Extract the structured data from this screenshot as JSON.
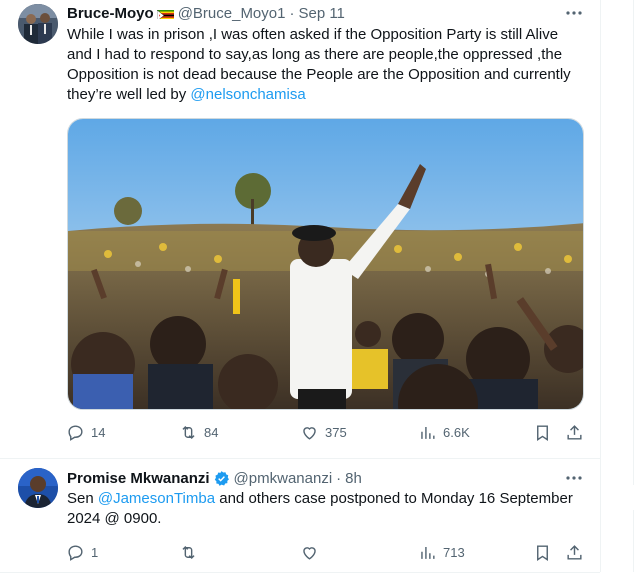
{
  "tweets": [
    {
      "author_name": "Bruce-Moyo",
      "flag_icon": "zimbabwe-flag-icon",
      "handle": "@Bruce_Moyo1",
      "dot": "·",
      "time": "Sep 11",
      "text_before": "While I was in prison ,I was often asked if the Opposition Party is still Alive and I had to respond to say,as long as there are people,the oppressed ,the Opposition is not dead because the People are the Opposition and currently they’re well led by ",
      "mention": "@nelsonchamisa",
      "text_after": "",
      "has_media": true,
      "replies": "14",
      "reposts": "84",
      "likes": "375",
      "views": "6.6K"
    },
    {
      "author_name": "Promise Mkwananzi",
      "verified_icon": "verified-badge-icon",
      "handle": "@pmkwananzi",
      "dot": "·",
      "time": "8h",
      "text_before": "Sen ",
      "mention": "@JamesonTimba",
      "text_after": " and others case postponed to Monday 16 September 2024 @ 0900.",
      "replies": "1",
      "reposts": "",
      "likes": "",
      "views": "713"
    }
  ],
  "colors": {
    "text": "#0f1419",
    "secondary": "#536471",
    "link": "#1d9bf0",
    "border": "#eff3f4",
    "verified": "#1d9bf0"
  }
}
